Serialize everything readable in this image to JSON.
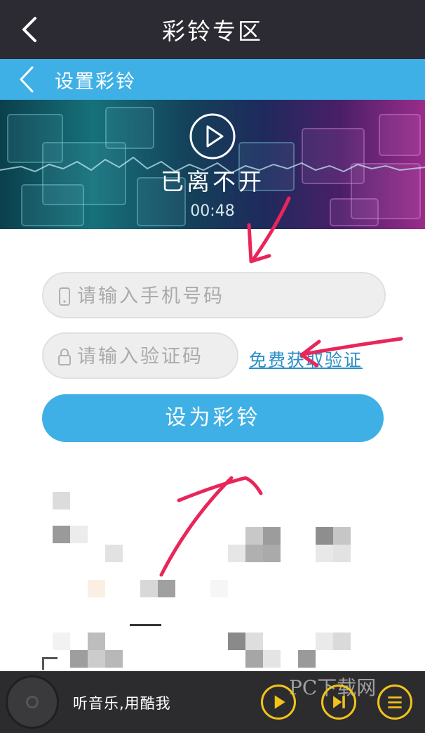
{
  "header": {
    "title": "彩铃专区"
  },
  "subheader": {
    "title": "设置彩铃"
  },
  "banner": {
    "song_title": "已离不开",
    "duration": "00:48"
  },
  "form": {
    "phone_placeholder": "请输入手机号码",
    "code_placeholder": "请输入验证码",
    "get_code_label": "免费获取验证",
    "submit_label": "设为彩铃"
  },
  "player": {
    "label": "听音乐,用酷我",
    "watermark": "PC下载网"
  },
  "colors": {
    "accent": "#3fb0e6",
    "header_bg": "#2c2a33",
    "link": "#2a8ec6",
    "annotation": "#e8265a",
    "player_button": "#f2c318"
  },
  "icons": {
    "header_back": "chevron-left-icon",
    "subheader_back": "chevron-left-icon",
    "banner_play": "play-circle-icon",
    "phone_field": "phone-icon",
    "code_field": "lock-icon",
    "player_play": "play-icon",
    "player_next": "next-icon",
    "player_list": "list-icon"
  }
}
